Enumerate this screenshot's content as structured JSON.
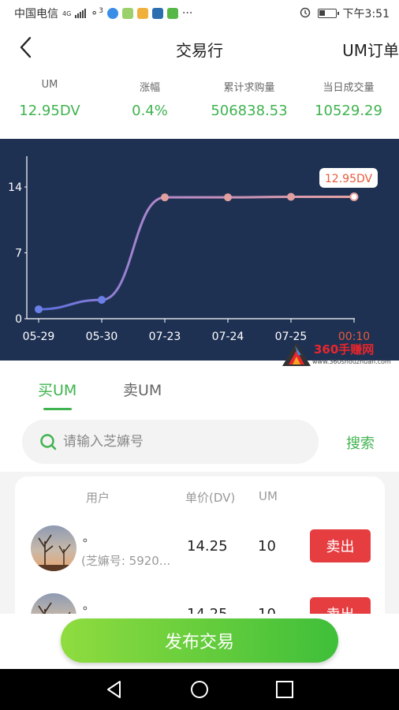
{
  "status_bar": {
    "carrier": "中国电信",
    "network": "4G",
    "wifi_badge": "3",
    "more": "···",
    "time": "下午3:51"
  },
  "header": {
    "title": "交易行",
    "right_link": "UM订单"
  },
  "stats": [
    {
      "label": "UM",
      "value": "12.95DV"
    },
    {
      "label": "涨幅",
      "value": "0.4%"
    },
    {
      "label": "累计求购量",
      "value": "506838.53"
    },
    {
      "label": "当日成交量",
      "value": "10529.29"
    }
  ],
  "chart_data": {
    "type": "line",
    "categories": [
      "05-29",
      "05-30",
      "07-23",
      "07-24",
      "07-25",
      "00:10"
    ],
    "series": [
      {
        "values": [
          1.0,
          2.0,
          12.9,
          12.9,
          12.95,
          12.95
        ]
      }
    ],
    "ylim": [
      0,
      14
    ],
    "yticks": [
      0,
      7,
      14
    ],
    "highlight": {
      "index": 5,
      "label": "12.95DV"
    },
    "colors": {
      "line_start": "#5b6fe0",
      "line_end": "#e8a3a0",
      "highlight_tick": "#e85a3a",
      "axis": "#ffffff",
      "background": "#1f3153"
    }
  },
  "watermark": {
    "title": "360手赚网",
    "url": "www.360shouzhuan.com"
  },
  "tabs": [
    {
      "label": "买UM",
      "active": true
    },
    {
      "label": "卖UM",
      "active": false
    }
  ],
  "search": {
    "placeholder": "请输入芝嫲号",
    "button": "搜索"
  },
  "table": {
    "headers": {
      "user": "用户",
      "price": "单价(DV)",
      "qty": "UM"
    },
    "rows": [
      {
        "name": "。",
        "id": "(芝嫲号: 5920...",
        "price": "14.25",
        "qty": "10",
        "action": "卖出"
      },
      {
        "name": "。",
        "id": "",
        "price": "14.25",
        "qty": "10",
        "action": "卖出"
      }
    ]
  },
  "publish_button": "发布交易"
}
